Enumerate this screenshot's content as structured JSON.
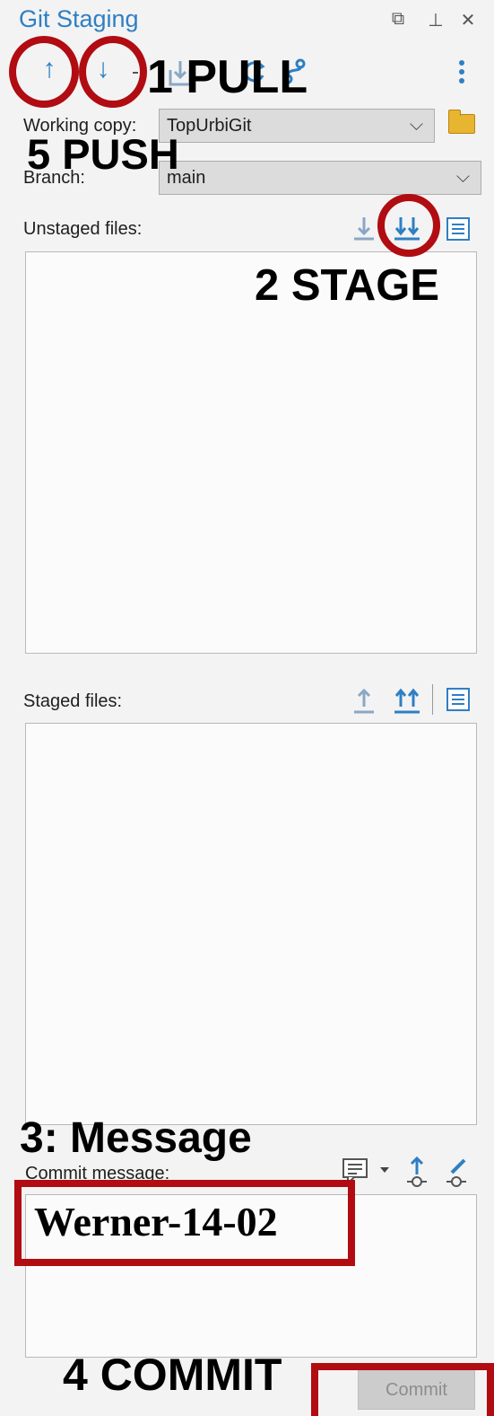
{
  "panel": {
    "title": "Git Staging",
    "window_controls": [
      "restore-icon",
      "pin-icon",
      "close-icon"
    ]
  },
  "toolbar": {
    "icons": [
      "push-arrow-up-icon",
      "pull-arrow-down-icon",
      "stash-icon",
      "refresh-icon",
      "branch-icon",
      "more-options-icon"
    ],
    "push_glyph": "↑",
    "pull_glyph": "↓"
  },
  "working_copy": {
    "label": "Working copy:",
    "value": "TopUrbiGit"
  },
  "branch": {
    "label": "Branch:",
    "value": "main"
  },
  "unstaged": {
    "label": "Unstaged files:",
    "items": []
  },
  "staged": {
    "label": "Staged files:",
    "items": []
  },
  "commit": {
    "label": "Commit message:",
    "message": "Werner-14-02",
    "button_label": "Commit"
  },
  "annotations": {
    "pull": "1 PULL",
    "stage": "2 STAGE",
    "message": "3: Message",
    "commit": "4 COMMIT",
    "push": "5 PUSH"
  },
  "colors": {
    "accent": "#2f7fc3",
    "annotation_red": "#b00c12",
    "folder": "#e8b531"
  }
}
